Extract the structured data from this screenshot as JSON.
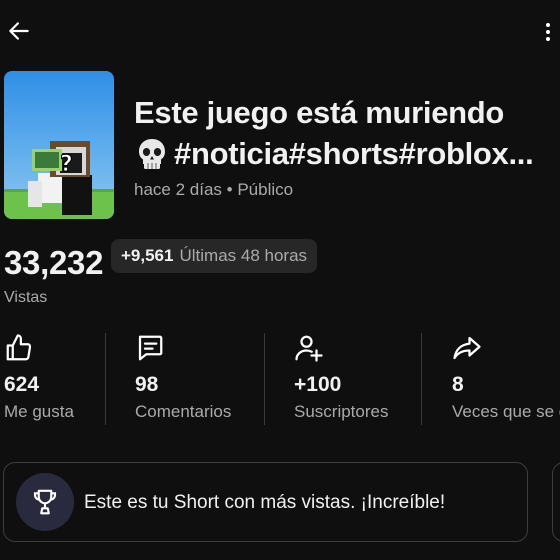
{
  "video": {
    "title_line1": "Este juego está muriendo",
    "title_line2": "#noticia#shorts#roblox...",
    "age": "hace 2 días",
    "separator": "•",
    "visibility": "Público"
  },
  "views": {
    "count": "33,232",
    "label": "Vistas",
    "delta": "+9,561",
    "period": "Últimas 48 horas"
  },
  "stats": [
    {
      "icon": "thumbs-up-icon",
      "value": "624",
      "label": "Me gusta"
    },
    {
      "icon": "comment-icon",
      "value": "98",
      "label": "Comentarios"
    },
    {
      "icon": "add-person-icon",
      "value": "+100",
      "label": "Suscriptores"
    },
    {
      "icon": "share-icon",
      "value": "8",
      "label": "Veces que se c"
    }
  ],
  "banner": {
    "icon": "trophy-icon",
    "text": "Este es tu Short con más vistas. ¡Increíble!"
  },
  "colors": {
    "background": "#0f0f0f",
    "text_primary": "#f1f1f1",
    "text_secondary": "#aaaaaa",
    "chip_background": "#272727",
    "trophy_background": "#2a2a3e"
  }
}
